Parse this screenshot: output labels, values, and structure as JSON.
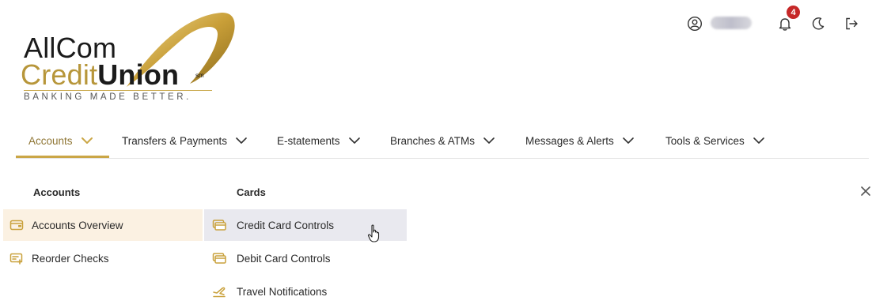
{
  "brand": {
    "line1": "AllCom",
    "line2_credit": "Credit",
    "line2_union": "Union",
    "service_mark": "sm",
    "tagline": "BANKING MADE BETTER."
  },
  "header": {
    "notification_count": "4",
    "icons": [
      "user-circle-icon",
      "bell-icon",
      "moon-icon",
      "logout-icon"
    ]
  },
  "nav": {
    "items": [
      {
        "label": "Accounts",
        "active": true
      },
      {
        "label": "Transfers & Payments",
        "active": false
      },
      {
        "label": "E-statements",
        "active": false
      },
      {
        "label": "Branches & ATMs",
        "active": false
      },
      {
        "label": "Messages & Alerts",
        "active": false
      },
      {
        "label": "Tools & Services",
        "active": false
      }
    ]
  },
  "menu": {
    "accounts_col": {
      "heading": "Accounts",
      "items": [
        {
          "label": "Accounts Overview",
          "icon": "wallet-icon"
        },
        {
          "label": "Reorder Checks",
          "icon": "checkbook-icon"
        }
      ]
    },
    "cards_col": {
      "heading": "Cards",
      "items": [
        {
          "label": "Credit Card Controls",
          "icon": "credit-card-icon"
        },
        {
          "label": "Debit Card Controls",
          "icon": "debit-card-icon"
        },
        {
          "label": "Travel Notifications",
          "icon": "plane-icon"
        }
      ]
    }
  },
  "colors": {
    "gold_accent": "#caa646",
    "gold_text": "#8e7533",
    "icon_gold": "#c9a13c",
    "badge_red": "#c62828",
    "hover_warm": "#fbf1e2",
    "hover_cool": "#e9e9ef"
  }
}
